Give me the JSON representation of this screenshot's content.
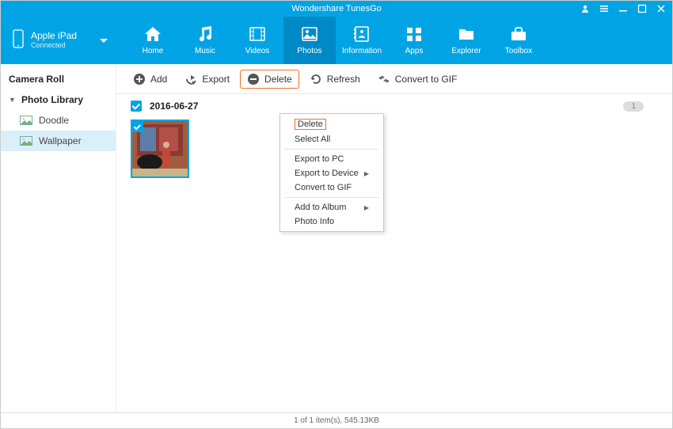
{
  "app": {
    "title": "Wondershare TunesGo"
  },
  "device": {
    "name": "Apple iPad",
    "status": "Connected"
  },
  "nav": {
    "home": "Home",
    "music": "Music",
    "videos": "Videos",
    "photos": "Photos",
    "information": "Information",
    "apps": "Apps",
    "explorer": "Explorer",
    "toolbox": "Toolbox"
  },
  "toolbar": {
    "add": "Add",
    "export": "Export",
    "delete": "Delete",
    "refresh": "Refresh",
    "convert": "Convert to GIF"
  },
  "sidebar": {
    "camera_roll": "Camera Roll",
    "photo_library": "Photo Library",
    "doodle": "Doodle",
    "wallpaper": "Wallpaper"
  },
  "section": {
    "date": "2016-06-27",
    "count": "1"
  },
  "context_menu": {
    "delete": "Delete",
    "select_all": "Select All",
    "export_pc": "Export to PC",
    "export_device": "Export to Device",
    "convert_gif": "Convert to GIF",
    "add_album": "Add to Album",
    "photo_info": "Photo Info"
  },
  "statusbar": {
    "text": "1 of 1 item(s), 545.13KB"
  }
}
